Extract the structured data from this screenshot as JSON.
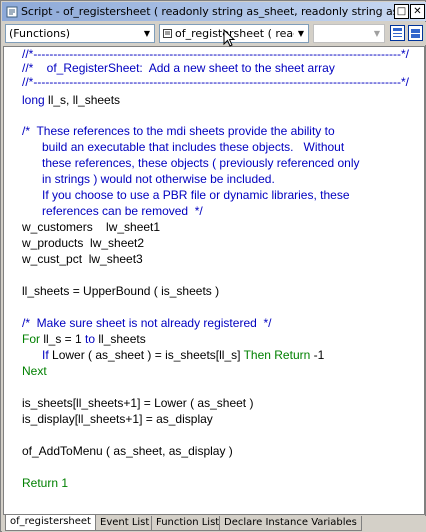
{
  "window": {
    "title": "Script - of_registersheet ( readonly string as_sheet, readonly string as_displ",
    "buttons": {
      "restore": "□",
      "close": "✕"
    }
  },
  "toolbar": {
    "object_combo": "(Functions)",
    "event_combo": "of_registersheet ( read",
    "ancestor_combo": ""
  },
  "code_lines": [
    "//*--------------------------------------------------------------------------------------------*/",
    "//*    of_RegisterSheet:  Add a new sheet to the sheet array",
    "//*--------------------------------------------------------------------------------------------*/",
    "long ll_s, ll_sheets",
    "",
    "/*  These references to the mdi sheets provide the ability to",
    "      build an executable that includes these objects.   Without",
    "      these references, these objects ( previously referenced only",
    "      in strings ) would not otherwise be included.",
    "      If you choose to use a PBR file or dynamic libraries, these",
    "      references can be removed  */",
    "w_customers    lw_sheet1",
    "w_products  lw_sheet2",
    "w_cust_pct  lw_sheet3",
    "",
    "ll_sheets = UpperBound ( is_sheets )",
    "",
    "/*  Make sure sheet is not already registered  */",
    "For ll_s = 1 to ll_sheets",
    "      If Lower ( as_sheet ) = is_sheets[ll_s] Then Return -1",
    "Next",
    "",
    "is_sheets[ll_sheets+1] = Lower ( as_sheet )",
    "is_display[ll_sheets+1] = as_display",
    "",
    "of_AddToMenu ( as_sheet, as_display )",
    "",
    "Return 1"
  ],
  "tabs": [
    {
      "label": "of_registersheet"
    },
    {
      "label": "Event List"
    },
    {
      "label": "Function List"
    },
    {
      "label": "Declare Instance Variables"
    }
  ],
  "colors": {
    "comment": "#0000c0",
    "keyword": "#0000c0",
    "green": "#008000",
    "titlebar": "#8da9d8"
  },
  "icons": [
    "script-icon",
    "restore-icon",
    "close-icon",
    "chevron-down-icon",
    "script-view-icon",
    "split-view-icon",
    "mouse-cursor-icon"
  ]
}
